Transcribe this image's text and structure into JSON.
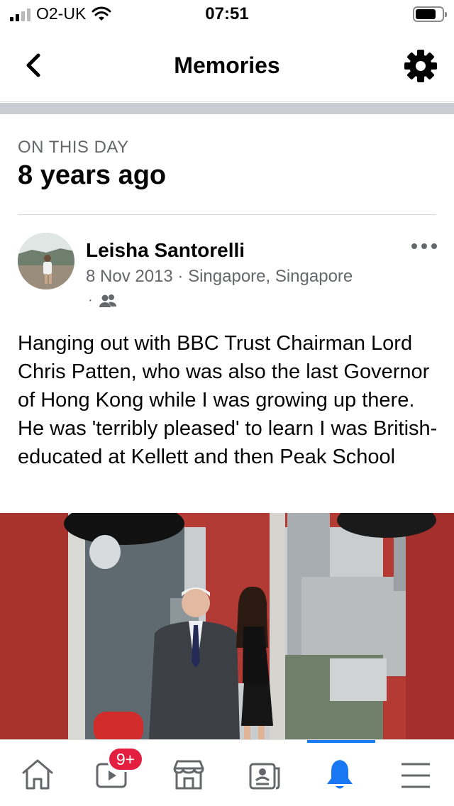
{
  "status_bar": {
    "carrier": "O2-UK",
    "time": "07:51"
  },
  "header": {
    "title": "Memories",
    "back_icon": "chevron-left-icon",
    "settings_icon": "gear-icon"
  },
  "memory": {
    "section_label": "ON THIS DAY",
    "years_ago": "8 years ago"
  },
  "post": {
    "author": "Leisha Santorelli",
    "meta": "8 Nov 2013 · Singapore, Singapore",
    "audience_dot": "·",
    "audience_icon": "friends-icon",
    "more_icon": "more-horizontal-icon",
    "text": "Hanging out with BBC Trust Chairman Lord Chris Patten, who was also the last Governor of Hong Kong while I was growing up there. He was 'terribly pleased' to learn I was British-educated at Kellett and then Peak School"
  },
  "tab_bar": {
    "tabs": [
      {
        "icon": "home-icon",
        "active": false
      },
      {
        "icon": "video-icon",
        "active": false,
        "badge": "9+"
      },
      {
        "icon": "marketplace-icon",
        "active": false
      },
      {
        "icon": "news-icon",
        "active": false
      },
      {
        "icon": "bell-icon",
        "active": true
      },
      {
        "icon": "menu-icon",
        "active": false
      }
    ],
    "active_color": "#1877f2",
    "badge_color": "#e41e3f"
  }
}
